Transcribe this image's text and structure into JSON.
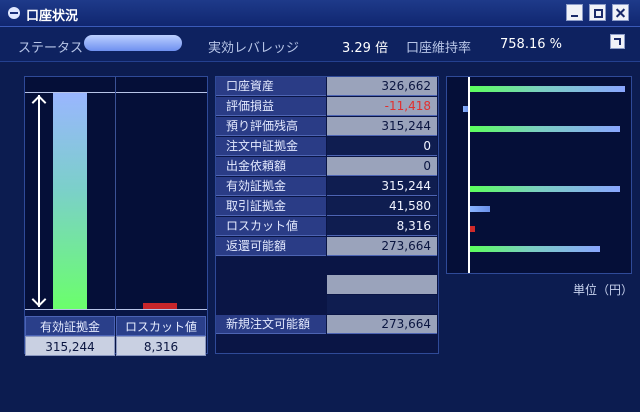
{
  "window": {
    "title": "口座状況"
  },
  "status": {
    "status_label": "ステータス",
    "leverage_label": "実効レバレッジ",
    "leverage_value": "3.29 倍",
    "maintenance_label": "口座維持率",
    "maintenance_value": "758.16 %"
  },
  "bar_chart": {
    "effective_margin_label": "有効証拠金",
    "effective_margin_value": "315,244",
    "effective_margin_level": 1.0,
    "losscut_label": "ロスカット値",
    "losscut_value": "8,316",
    "losscut_level": 0.027
  },
  "table": {
    "rows": [
      {
        "label": "口座資産",
        "value": "326,662",
        "tone": "light"
      },
      {
        "label": "評価損益",
        "value": "-11,418",
        "tone": "light",
        "negative": true
      },
      {
        "label": "預り評価残高",
        "value": "315,244",
        "tone": "light"
      },
      {
        "label": "注文中証拠金",
        "value": "0",
        "tone": "dark"
      },
      {
        "label": "出金依頼額",
        "value": "0",
        "tone": "light"
      },
      {
        "label": "有効証拠金",
        "value": "315,244",
        "tone": "dark"
      },
      {
        "label": "取引証拠金",
        "value": "41,580",
        "tone": "dark"
      },
      {
        "label": "ロスカット値",
        "value": "8,316",
        "tone": "dark"
      },
      {
        "label": "返還可能額",
        "value": "273,664",
        "tone": "light"
      }
    ],
    "new_order_label": "新規注文可能額",
    "new_order_value": "273,664"
  },
  "hbar_chart": {
    "max_value": 326662,
    "bars": [
      {
        "value": 326662,
        "color": "green-blue"
      },
      {
        "value": -11418,
        "color": "blue"
      },
      {
        "value": 315244,
        "color": "green-blue"
      },
      {
        "value": 0,
        "color": "none"
      },
      {
        "value": 0,
        "color": "none"
      },
      {
        "value": 315244,
        "color": "green-blue"
      },
      {
        "value": 41580,
        "color": "blue"
      },
      {
        "value": 8316,
        "color": "red"
      },
      {
        "value": 273664,
        "color": "green-blue"
      }
    ],
    "unit_label": "単位（円）"
  },
  "colors": {
    "background": "#0a1a4a",
    "accent_green": "#6bff6b",
    "accent_blue": "#8aaaff",
    "negative": "#e03030"
  }
}
